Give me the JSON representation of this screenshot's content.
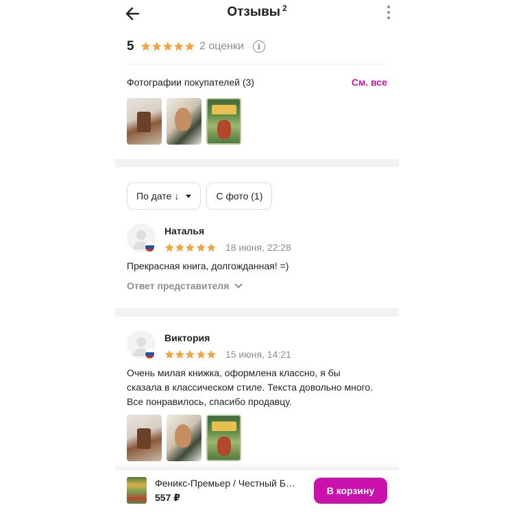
{
  "header": {
    "title": "Отзывы",
    "count": "2"
  },
  "summary": {
    "score": "5",
    "stars": 5,
    "ratings_count": "2 оценки",
    "info_glyph": "i"
  },
  "photos": {
    "title": "Фотографии покупателей (3)",
    "see_all": "См. все",
    "thumbs": [
      "book-page-photo",
      "book-illustration-photo",
      "book-cover-photo"
    ]
  },
  "filters": {
    "sort_label": "По дате ↓",
    "photo_filter_label": "С фото (1)"
  },
  "reviews": [
    {
      "name": "Наталья",
      "stars": 5,
      "date": "18 июня, 22:28",
      "text": "Прекрасная книга, долгожданная! =)",
      "answer_label": "Ответ представителя",
      "photos": []
    },
    {
      "name": "Виктория",
      "stars": 5,
      "date": "15 июня, 14:21",
      "text": "Очень милая книжка, оформлена классно, я бы сказала в классическом стиле. Текста довольно много. Все понравилось, спасибо продавцу.",
      "photos": [
        "book-page-photo",
        "book-illustration-photo",
        "book-cover-photo"
      ]
    }
  ],
  "bottom_bar": {
    "product_name": "Феникс-Премьер / Честный Б…",
    "price": "557 ₽",
    "cart_button": "В корзину"
  },
  "colors": {
    "accent": "#cb11ab",
    "star": "#f4a33c",
    "muted_text": "#8c8c8c",
    "band": "#f2f2f2"
  },
  "icons": [
    "arrow-left-icon",
    "more-vertical-icon",
    "star-icon",
    "info-icon",
    "chevron-down-icon",
    "russia-flag-icon",
    "avatar-placeholder-icon"
  ]
}
